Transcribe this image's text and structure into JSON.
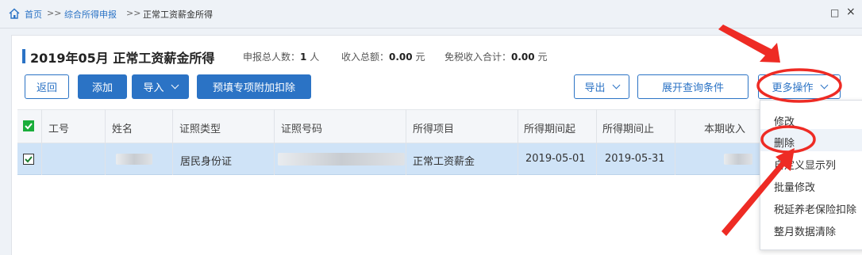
{
  "breadcrumb": {
    "home": "首页",
    "sep1": ">>",
    "item1": "综合所得申报",
    "sep2": ">>",
    "current": "正常工资薪金所得"
  },
  "window": {
    "restore": "□",
    "close": "×"
  },
  "header": {
    "title": "2019年05月 正常工资薪金所得",
    "count_label": "申报总人数：",
    "count_value": "1",
    "count_unit": "人",
    "income_label": "收入总额：",
    "income_value": "0.00",
    "income_unit": "元",
    "taxfree_label": "免税收入合计：",
    "taxfree_value": "0.00",
    "taxfree_unit": "元"
  },
  "toolbar": {
    "back": "返回",
    "add": "添加",
    "import": "导入",
    "prefill": "预填专项附加扣除",
    "export": "导出",
    "expand": "展开查询条件",
    "more": "更多操作"
  },
  "table": {
    "headers": [
      "工号",
      "姓名",
      "证照类型",
      "证照号码",
      "所得项目",
      "所得期间起",
      "所得期间止",
      "本期收入"
    ],
    "rows": [
      {
        "id_type": "居民身份证",
        "income_item": "正常工资薪金",
        "start": "2019-05-01",
        "end": "2019-05-31"
      }
    ]
  },
  "more_menu": {
    "items": [
      "修改",
      "删除",
      "自定义显示列",
      "批量修改",
      "税延养老保险扣除",
      "整月数据清除"
    ]
  },
  "colors": {
    "accent": "#2b73c5",
    "annotation": "#ee2b24",
    "row_selected": "#cfe3f7"
  },
  "icons": [
    "home-icon",
    "checkbox-icon",
    "chevron-down-icon"
  ]
}
